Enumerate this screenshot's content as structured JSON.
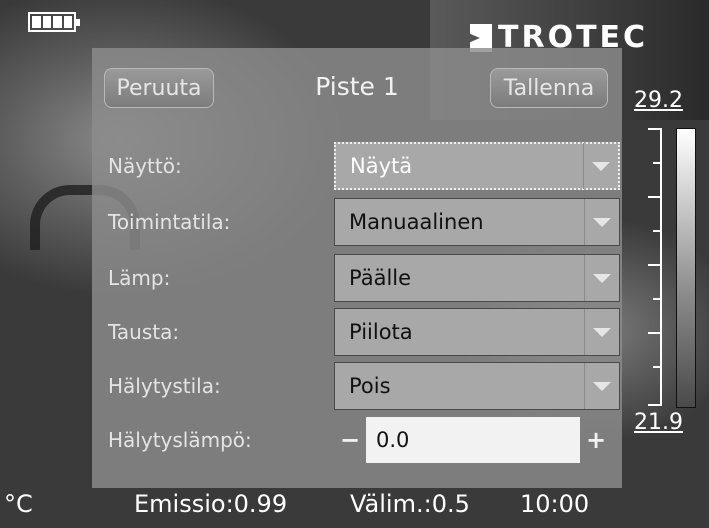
{
  "device": {
    "brand": "TROTEC"
  },
  "scale": {
    "max": "29.2",
    "min": "21.9"
  },
  "dialog": {
    "cancel_label": "Peruuta",
    "title": "Piste 1",
    "save_label": "Tallenna",
    "rows": [
      {
        "label": "Näyttö:",
        "value": "Näytä"
      },
      {
        "label": "Toimintatila:",
        "value": "Manuaalinen"
      },
      {
        "label": "Lämp:",
        "value": "Päälle"
      },
      {
        "label": "Tausta:",
        "value": "Piilota"
      },
      {
        "label": "Hälytystila:",
        "value": "Pois"
      }
    ],
    "alarm_temp": {
      "label": "Hälytyslämpö:",
      "value": "0.0",
      "minus": "−",
      "plus": "+"
    }
  },
  "status": {
    "unit": "°C",
    "emission": "Emissio:0.99",
    "distance": "Välim.:0.5",
    "time": "10:00"
  }
}
